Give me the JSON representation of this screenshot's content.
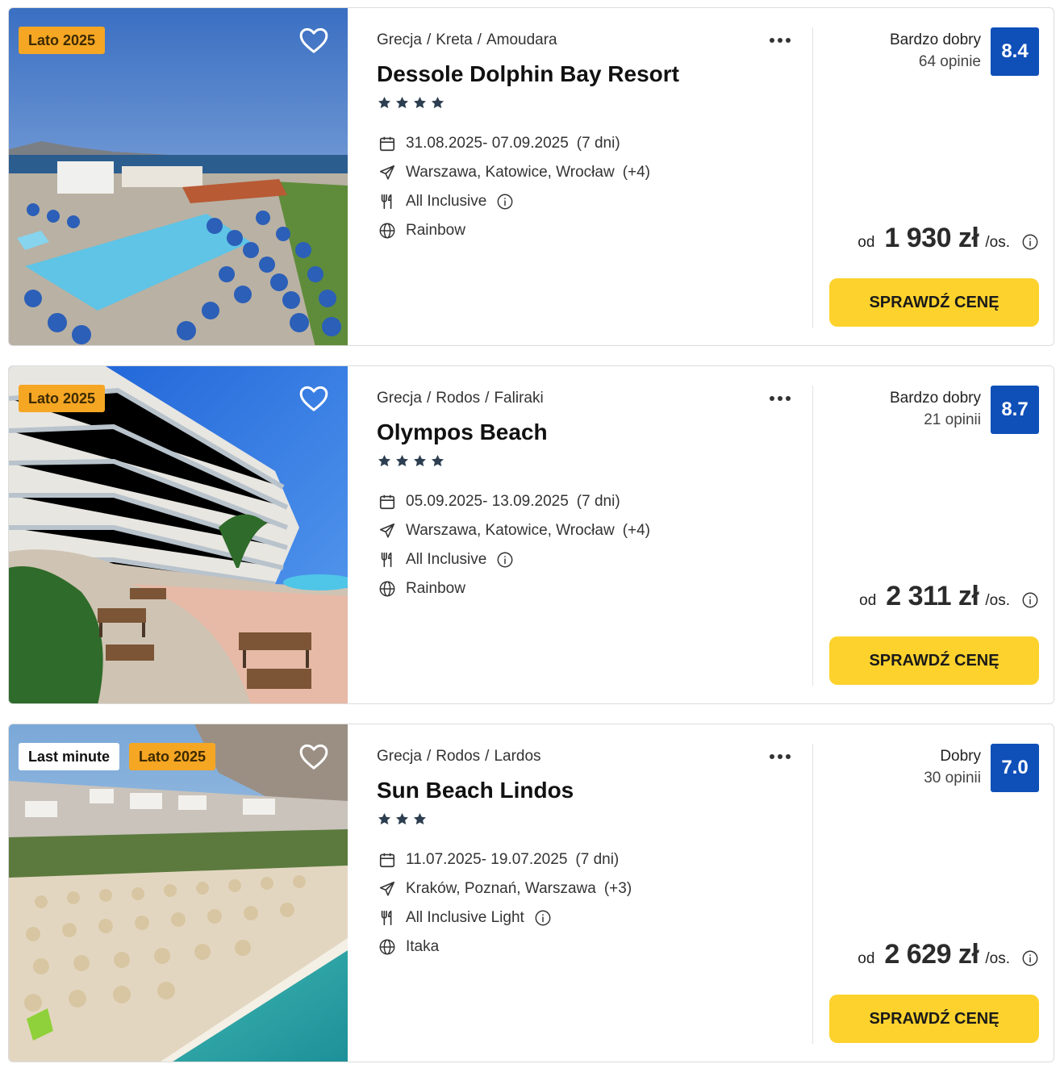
{
  "offers": [
    {
      "badges": [
        "Lato 2025"
      ],
      "location": [
        "Grecja",
        "Kreta",
        "Amoudara"
      ],
      "name": "Dessole Dolphin Bay Resort",
      "stars": 4,
      "dates": "31.08.2025- 07.09.2025",
      "duration": "(7 dni)",
      "departures": "Warszawa, Katowice, Wrocław",
      "departures_more": "(+4)",
      "board": "All Inclusive",
      "operator": "Rainbow",
      "rating_label": "Bardzo dobry",
      "reviews": "64 opinie",
      "score": "8.4",
      "price_prefix": "od",
      "price": "1 930 zł",
      "price_unit": "/os.",
      "cta": "SPRAWDŹ CENĘ"
    },
    {
      "badges": [
        "Lato 2025"
      ],
      "location": [
        "Grecja",
        "Rodos",
        "Faliraki"
      ],
      "name": "Olympos Beach",
      "stars": 4,
      "dates": "05.09.2025- 13.09.2025",
      "duration": "(7 dni)",
      "departures": "Warszawa, Katowice, Wrocław",
      "departures_more": "(+4)",
      "board": "All Inclusive",
      "operator": "Rainbow",
      "rating_label": "Bardzo dobry",
      "reviews": "21 opinii",
      "score": "8.7",
      "price_prefix": "od",
      "price": "2 311 zł",
      "price_unit": "/os.",
      "cta": "SPRAWDŹ CENĘ"
    },
    {
      "badges": [
        "Last minute",
        "Lato 2025"
      ],
      "location": [
        "Grecja",
        "Rodos",
        "Lardos"
      ],
      "name": "Sun Beach Lindos",
      "stars": 3,
      "dates": "11.07.2025- 19.07.2025",
      "duration": "(7 dni)",
      "departures": "Kraków, Poznań, Warszawa",
      "departures_more": "(+3)",
      "board": "All Inclusive Light",
      "operator": "Itaka",
      "rating_label": "Dobry",
      "reviews": "30 opinii",
      "score": "7.0",
      "price_prefix": "od",
      "price": "2 629 zł",
      "price_unit": "/os.",
      "cta": "SPRAWDŹ CENĘ"
    }
  ],
  "icons": {
    "favorite": "heart-outline-icon",
    "more": "more-dots-icon",
    "stars": "star-icon",
    "dates": "calendar-icon",
    "departures": "plane-icon",
    "board": "cutlery-icon",
    "operator": "globe-icon",
    "info": "info-icon"
  },
  "colors": {
    "season_badge": "#f5a623",
    "score_badge": "#0f4fb8",
    "cta": "#fdd22c",
    "star": "#2c3e50"
  }
}
